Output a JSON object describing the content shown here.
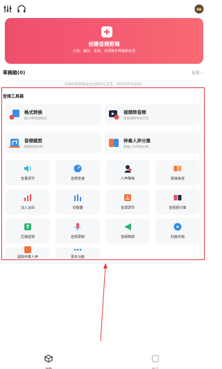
{
  "hero": {
    "title": "创建音频剪辑",
    "subtitle": "分割、裁剪、变速、变调等多种编辑处理"
  },
  "drafts": {
    "title": "草稿箱(0)",
    "all_label": "全部 ›",
    "empty_hint": "剪辑的草稿箱会自动保存在这里，使点同作作品吧~"
  },
  "toolbox": {
    "title": "音频工具箱",
    "big_tools": [
      {
        "label": "格式转换",
        "desc": "超20种音频格式",
        "icon": "format-convert-icon"
      },
      {
        "label": "视频转音频",
        "desc": "提取视频中的声音",
        "icon": "video-to-audio-icon"
      },
      {
        "label": "音频裁剪",
        "desc": "精确到每秒钟",
        "icon": "audio-trim-icon"
      },
      {
        "label": "伴奏人声分离",
        "desc": "歌曲人声单独分离",
        "icon": "vocal-separate-icon"
      }
    ],
    "small_tools": [
      {
        "label": "音量调节",
        "icon": "volume-icon",
        "color": "#2ab7d6"
      },
      {
        "label": "音频变速",
        "icon": "speed-icon",
        "color": "#3a8ee6"
      },
      {
        "label": "人声降噪",
        "icon": "denoise-icon",
        "color": "#1f2a44"
      },
      {
        "label": "拼接串烧",
        "icon": "splice-icon",
        "color": "#f0733f"
      },
      {
        "label": "淡入淡出",
        "icon": "fade-icon",
        "color": "#f04e4e"
      },
      {
        "label": "均衡器",
        "icon": "equalizer-icon",
        "color": "#3a8ee6"
      },
      {
        "label": "音调调节",
        "icon": "pitch-icon",
        "color": "#f0733f"
      },
      {
        "label": "音视频分离",
        "icon": "av-separate-icon",
        "color": "#e84b6a"
      },
      {
        "label": "压缩音频",
        "icon": "compress-icon",
        "color": "#2fb36f"
      },
      {
        "label": "音频录制",
        "icon": "record-icon",
        "color": "#e84b6a"
      },
      {
        "label": "音频倒放",
        "icon": "reverse-icon",
        "color": "#2fb36f"
      },
      {
        "label": "封面专辑",
        "icon": "album-cover-icon",
        "color": "#3a8ee6"
      },
      {
        "label": "提取伴奏人声",
        "icon": "extract-vocal-icon",
        "color": "#f0733f"
      },
      {
        "label": "更多功能",
        "icon": "more-icon",
        "color": "#3a8ee6"
      }
    ]
  },
  "nav": {
    "tab1": "功能",
    "tab2": "作品"
  },
  "colors": {
    "accent": "#f1536d",
    "annotation": "#e53935"
  }
}
